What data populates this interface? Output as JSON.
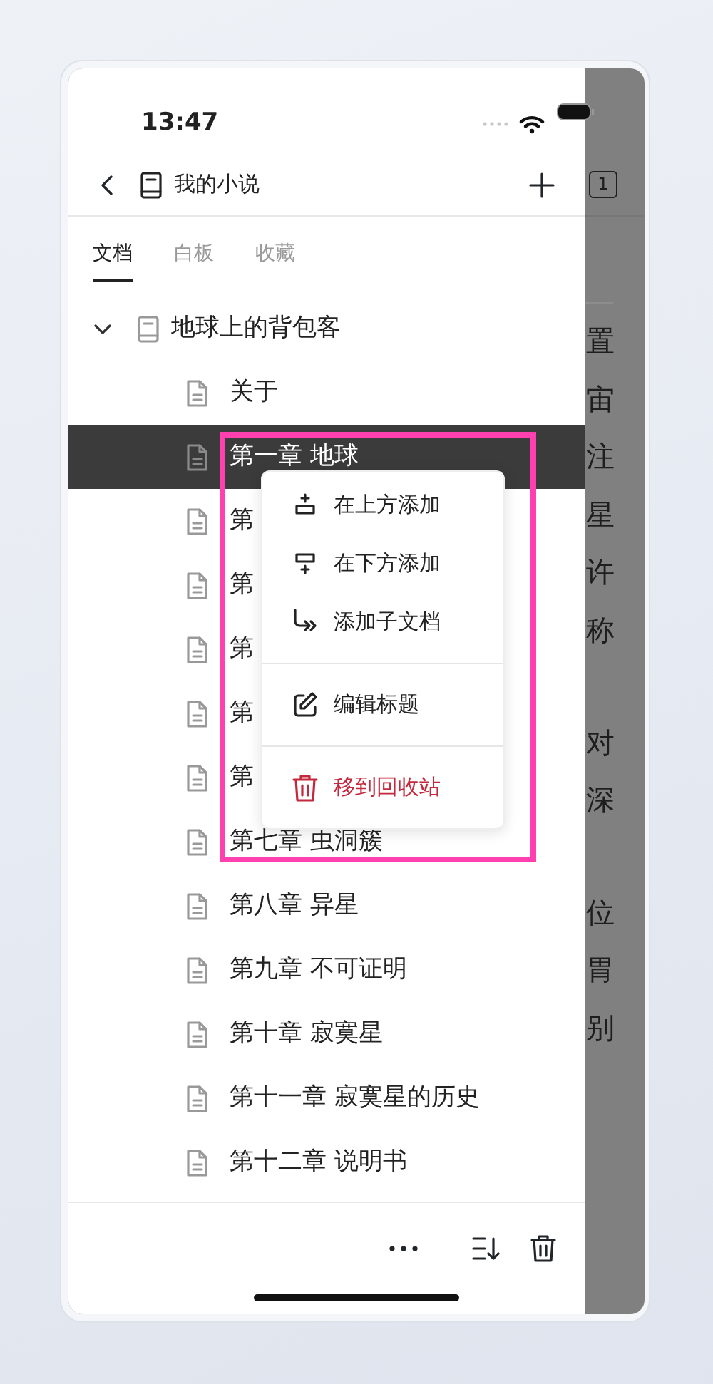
{
  "status_bar": {
    "time": "13:47"
  },
  "header": {
    "title": "我的小说"
  },
  "tabs": [
    {
      "label": "文档",
      "selected": true
    },
    {
      "label": "白板",
      "selected": false
    },
    {
      "label": "收藏",
      "selected": false
    }
  ],
  "tree": {
    "title": "地球上的背包客",
    "expanded": true,
    "children": [
      {
        "title": "关于",
        "selected": false
      },
      {
        "title": "第一章 地球",
        "selected": true
      },
      {
        "title": "第",
        "selected": false
      },
      {
        "title": "第",
        "selected": false
      },
      {
        "title": "第",
        "selected": false
      },
      {
        "title": "第",
        "selected": false
      },
      {
        "title": "第",
        "selected": false
      },
      {
        "title": "第七章 虫洞簇",
        "selected": false
      },
      {
        "title": "第八章 异星",
        "selected": false
      },
      {
        "title": "第九章 不可证明",
        "selected": false
      },
      {
        "title": "第十章 寂寞星",
        "selected": false
      },
      {
        "title": "第十一章 寂寞星的历史",
        "selected": false
      },
      {
        "title": "第十二章 说明书",
        "selected": false
      }
    ]
  },
  "context_menu": {
    "sections": [
      [
        {
          "label": "在上方添加",
          "kind": "normal"
        },
        {
          "label": "在下方添加",
          "kind": "normal"
        },
        {
          "label": "添加子文档",
          "kind": "normal"
        }
      ],
      [
        {
          "label": "编辑标题",
          "kind": "normal"
        }
      ],
      [
        {
          "label": "移到回收站",
          "kind": "danger"
        }
      ]
    ]
  },
  "background_page": {
    "tab_count": "1",
    "paragraphs": [
      [
        "置",
        "宙",
        "注",
        "星",
        "许",
        "称"
      ],
      [
        "对",
        "深"
      ],
      [
        "位",
        "胃",
        "别"
      ]
    ]
  }
}
